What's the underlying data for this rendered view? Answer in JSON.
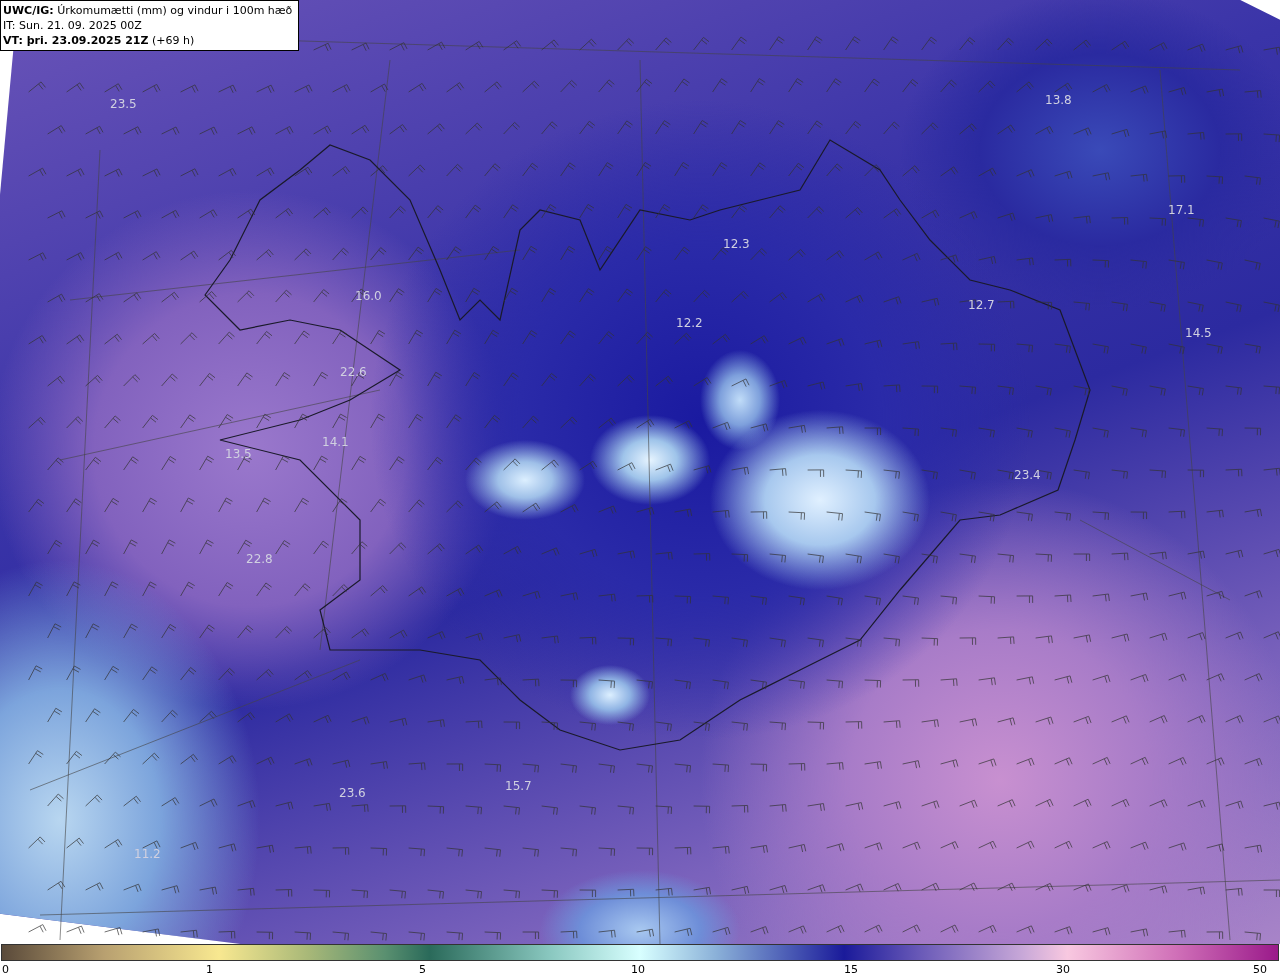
{
  "header": {
    "model": "UWC/IG:",
    "title": "Úrkomumætti (mm) og vindur i 100m hæð",
    "initial_time": "IT: Sun. 21. 09. 2025 00Z",
    "valid_time": "VT: þri. 23.09.2025 21Z",
    "lead": "(+69 h)"
  },
  "map_labels": [
    {
      "text": "23.5"
    },
    {
      "text": "13.8"
    },
    {
      "text": "17.1"
    },
    {
      "text": "16.0"
    },
    {
      "text": "12.3"
    },
    {
      "text": "12.2"
    },
    {
      "text": "12.7"
    },
    {
      "text": "14.5"
    },
    {
      "text": "22.6"
    },
    {
      "text": "14.1"
    },
    {
      "text": "13.5"
    },
    {
      "text": "23.4"
    },
    {
      "text": "22.8"
    },
    {
      "text": "23.6"
    },
    {
      "text": "15.7"
    },
    {
      "text": "11.2"
    }
  ],
  "colorbar": {
    "ticks": [
      "0",
      "1",
      "5",
      "10",
      "15",
      "30",
      "50"
    ]
  }
}
